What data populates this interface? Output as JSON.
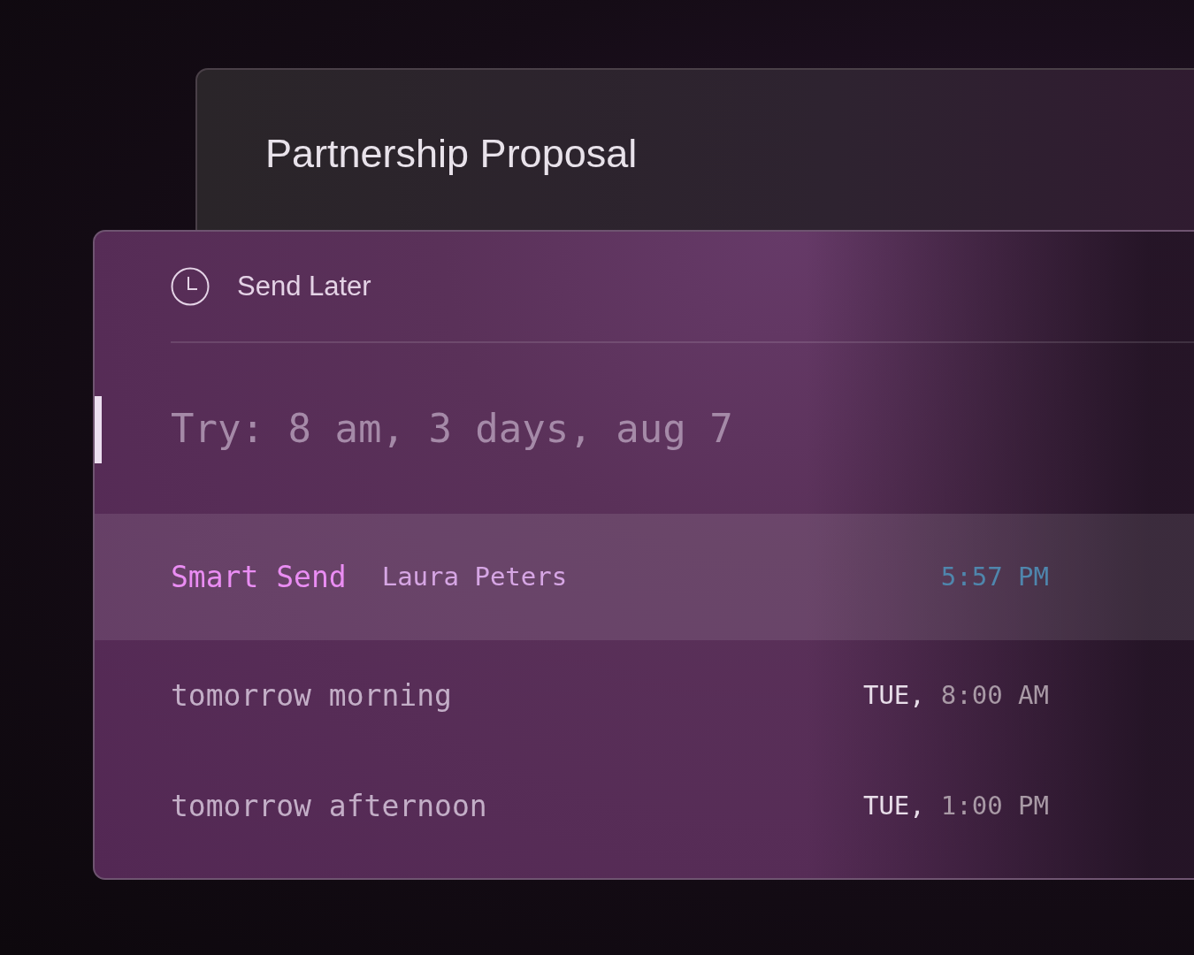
{
  "draft": {
    "title": "Partnership Proposal"
  },
  "send_later": {
    "title": "Send Later",
    "input": {
      "placeholder": "Try: 8 am, 3 days, aug 7",
      "focused": true
    },
    "options": [
      {
        "kind": "smart",
        "label": "Smart Send",
        "contact": "Laura Peters",
        "time": "5:57 PM",
        "selected": true
      },
      {
        "kind": "preset",
        "label": "tomorrow morning",
        "day": "TUE,",
        "time": "8:00 AM",
        "selected": false
      },
      {
        "kind": "preset",
        "label": "tomorrow afternoon",
        "day": "TUE,",
        "time": "1:00 PM",
        "selected": false
      }
    ]
  }
}
